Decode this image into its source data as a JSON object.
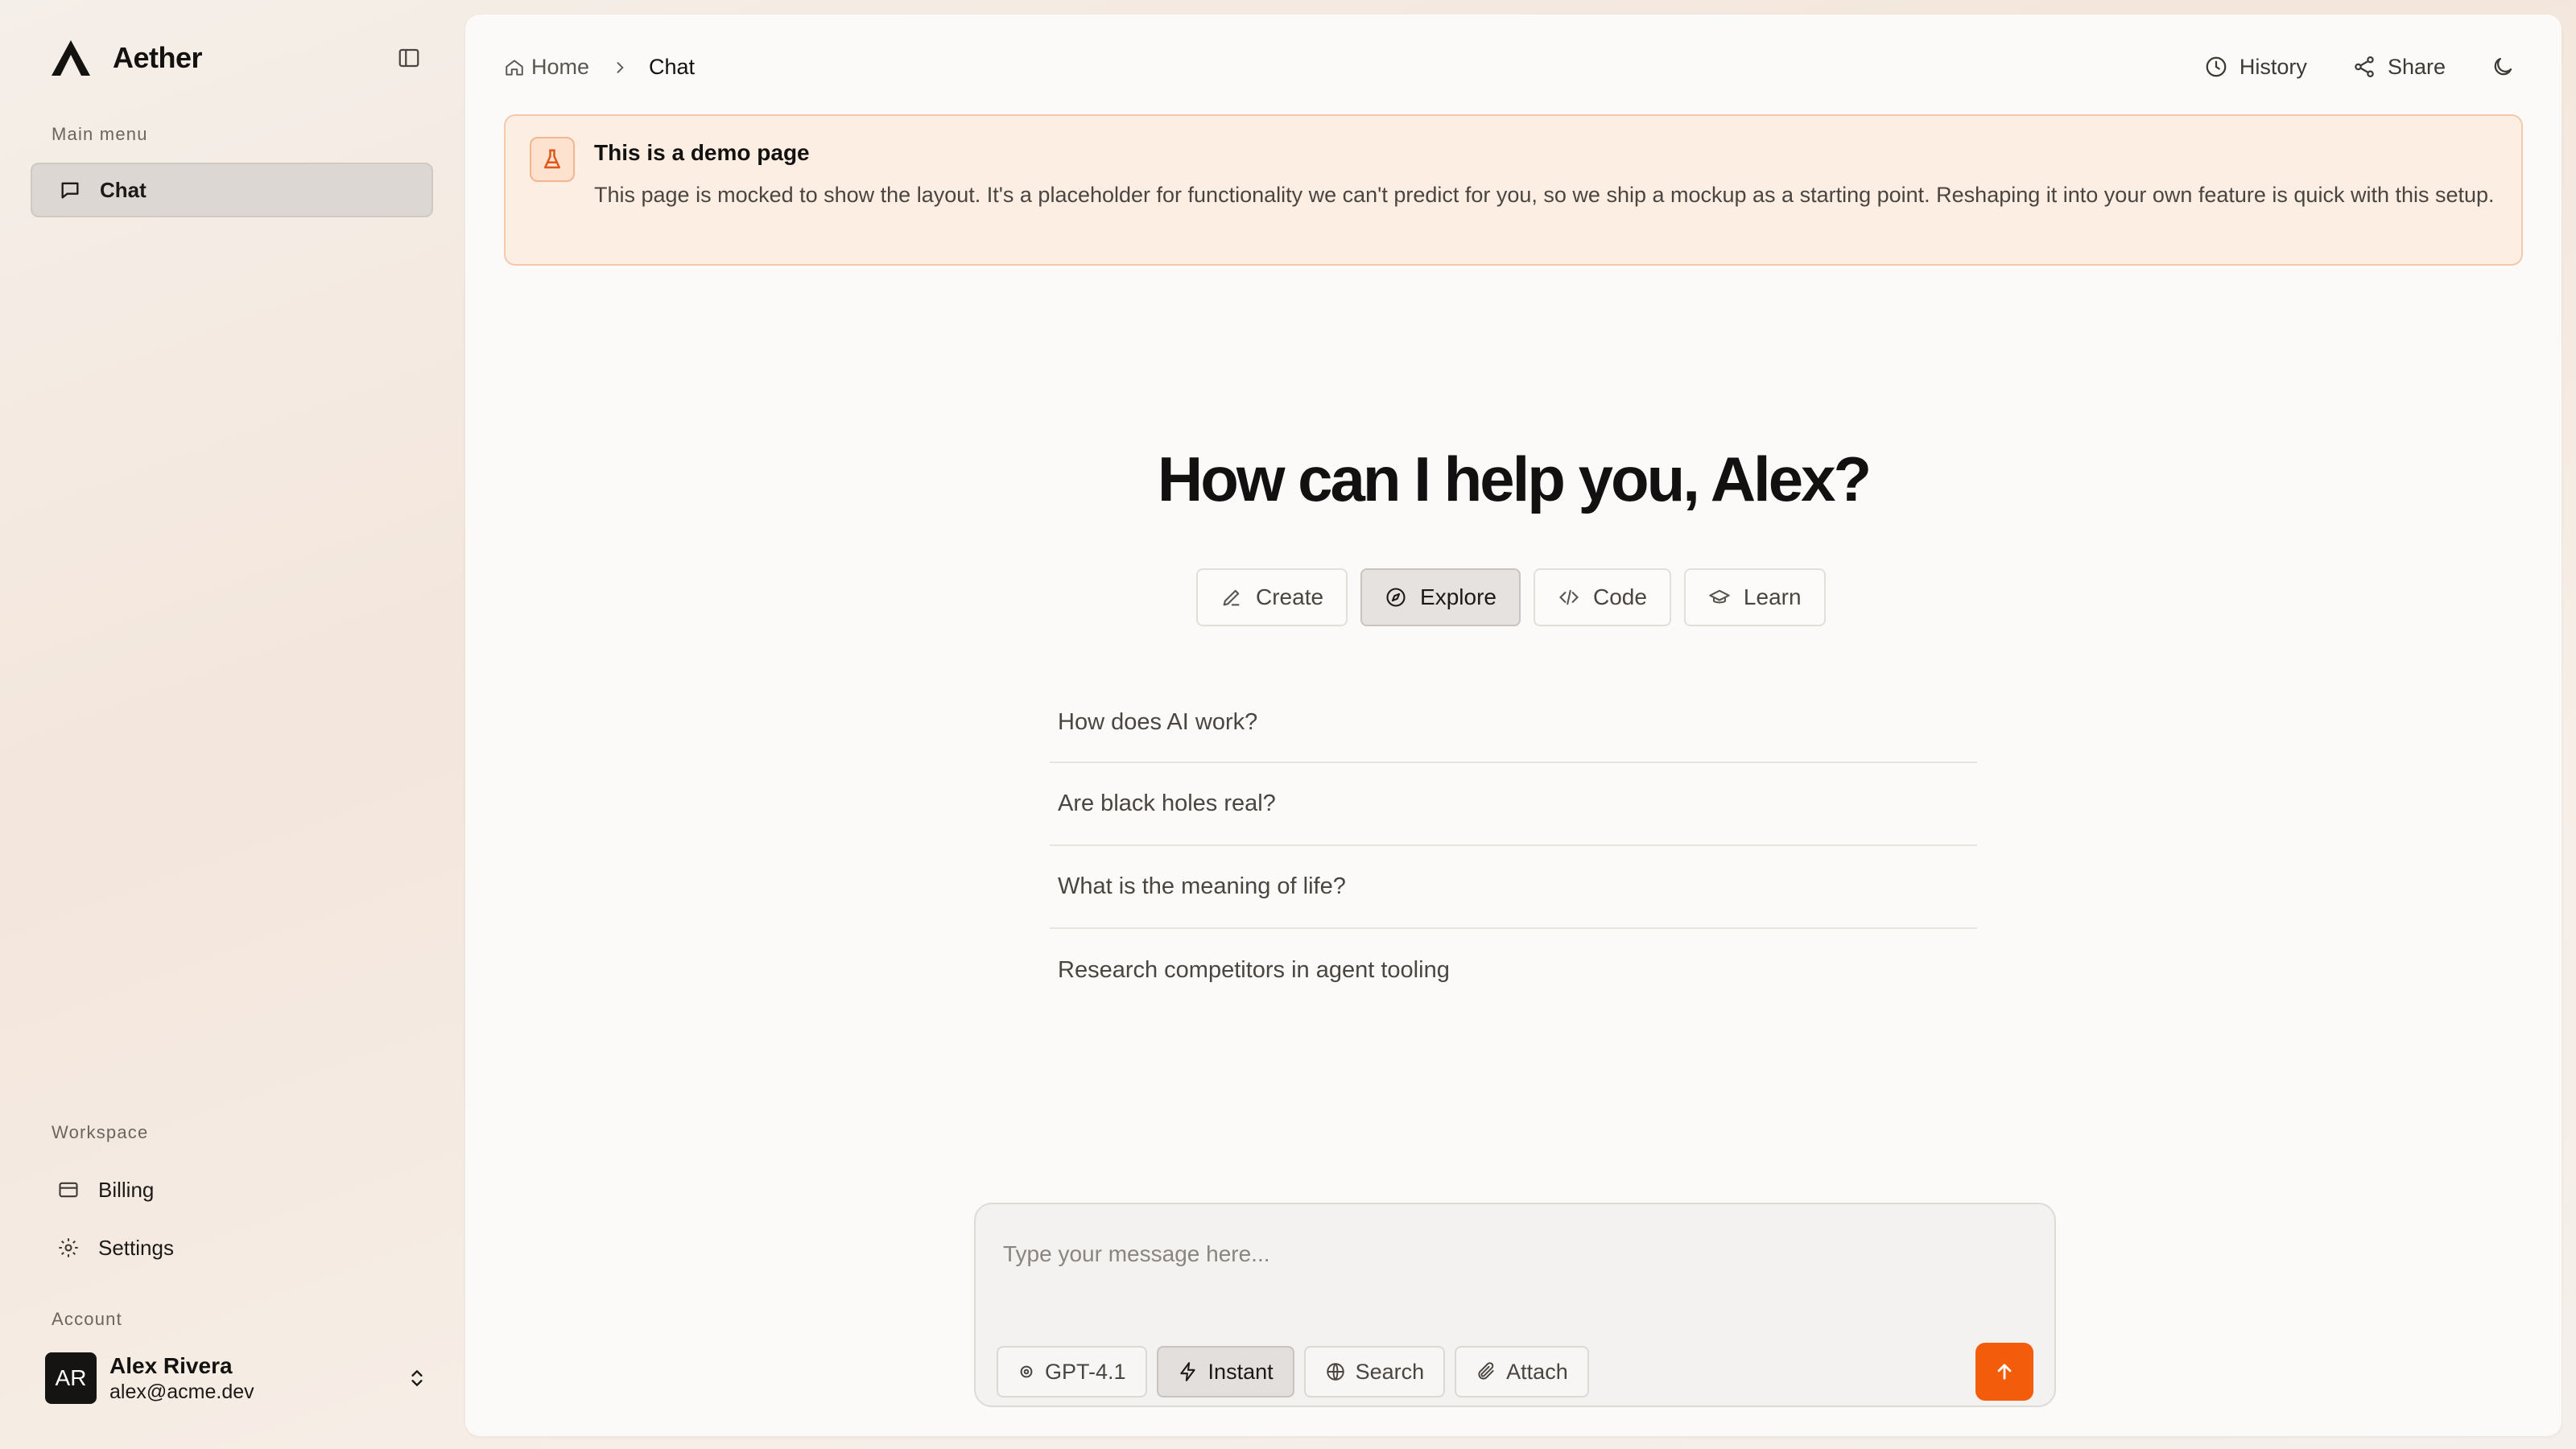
{
  "app": {
    "name": "Aether"
  },
  "sidebar": {
    "main_menu_label": "Main menu",
    "main_items": [
      {
        "label": "Chat",
        "icon": "message-square-icon",
        "active": true
      }
    ],
    "workspace_label": "Workspace",
    "workspace_items": [
      {
        "label": "Billing",
        "icon": "credit-card-icon"
      },
      {
        "label": "Settings",
        "icon": "gear-icon"
      }
    ],
    "account_label": "Account",
    "account": {
      "initials": "AR",
      "name": "Alex Rivera",
      "email": "alex@acme.dev"
    }
  },
  "header": {
    "breadcrumb": {
      "home": "Home",
      "current": "Chat"
    },
    "actions": {
      "history": "History",
      "share": "Share"
    }
  },
  "banner": {
    "title": "This is a demo page",
    "text": "This page is mocked to show the layout. It's a placeholder for functionality we can't predict for you, so we ship a mockup as a starting point. Reshaping it into your own feature is quick with this setup."
  },
  "hero": {
    "title": "How can I help you, Alex?"
  },
  "modes": [
    {
      "label": "Create",
      "icon": "pencil-icon",
      "active": false
    },
    {
      "label": "Explore",
      "icon": "compass-icon",
      "active": true
    },
    {
      "label": "Code",
      "icon": "code-icon",
      "active": false
    },
    {
      "label": "Learn",
      "icon": "graduation-cap-icon",
      "active": false
    }
  ],
  "suggestions": [
    "How does AI work?",
    "Are black holes real?",
    "What is the meaning of life?",
    "Research competitors in agent tooling"
  ],
  "composer": {
    "placeholder": "Type your message here...",
    "model": "GPT-4.1",
    "instant": "Instant",
    "search": "Search",
    "attach": "Attach"
  },
  "colors": {
    "accent": "#f25c0a",
    "banner_bg": "#fdeee3",
    "banner_border": "#f3c8ab"
  }
}
